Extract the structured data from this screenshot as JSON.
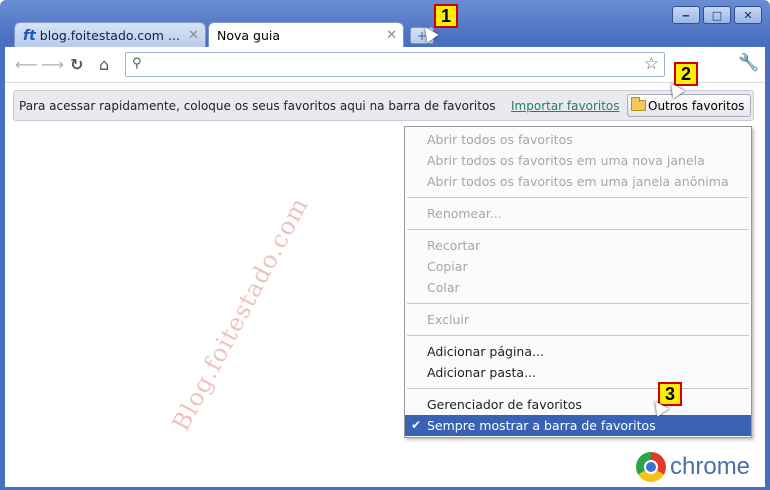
{
  "window": {
    "controls": {
      "minimize": "‒",
      "maximize": "□",
      "close": "✕"
    }
  },
  "tabs": [
    {
      "favicon": "ft",
      "title": "blog.foitestado.com ...",
      "close": "✕"
    },
    {
      "title": "Nova guia",
      "close": "✕"
    }
  ],
  "new_tab_button": "+",
  "toolbar": {
    "icons": [
      "back-icon",
      "forward-icon",
      "reload-icon",
      "home-icon",
      "search-icon",
      "star-icon",
      "wrench-icon"
    ],
    "omnibox_value": ""
  },
  "bookmarks_bar": {
    "message": "Para acessar rapidamente, coloque os seus favoritos aqui na barra de favoritos",
    "import_link": "Importar favoritos",
    "other_bookmarks": "Outros favoritos"
  },
  "context_menu": {
    "groups": [
      [
        {
          "label": "Abrir todos os favoritos",
          "enabled": false
        },
        {
          "label": "Abrir todos os favoritos em uma nova janela",
          "enabled": false
        },
        {
          "label": "Abrir todos os favoritos em uma janela anônima",
          "enabled": false
        }
      ],
      [
        {
          "label": "Renomear...",
          "enabled": false
        }
      ],
      [
        {
          "label": "Recortar",
          "enabled": false
        },
        {
          "label": "Copiar",
          "enabled": false
        },
        {
          "label": "Colar",
          "enabled": false
        }
      ],
      [
        {
          "label": "Excluir",
          "enabled": false
        }
      ],
      [
        {
          "label": "Adicionar página...",
          "enabled": true
        },
        {
          "label": "Adicionar pasta...",
          "enabled": true
        }
      ],
      [
        {
          "label": "Gerenciador de favoritos",
          "enabled": true
        },
        {
          "label": "Sempre mostrar a barra de favoritos",
          "enabled": true,
          "checked": true,
          "highlighted": true
        }
      ]
    ],
    "check_mark": "✔"
  },
  "callouts": [
    "1",
    "2",
    "3"
  ],
  "watermark": "Blog.foitestado.com",
  "logo_text": "chrome",
  "colors": {
    "accent": "#3a62b4",
    "link": "#2a7b74",
    "frame": "#4a6fc0"
  }
}
